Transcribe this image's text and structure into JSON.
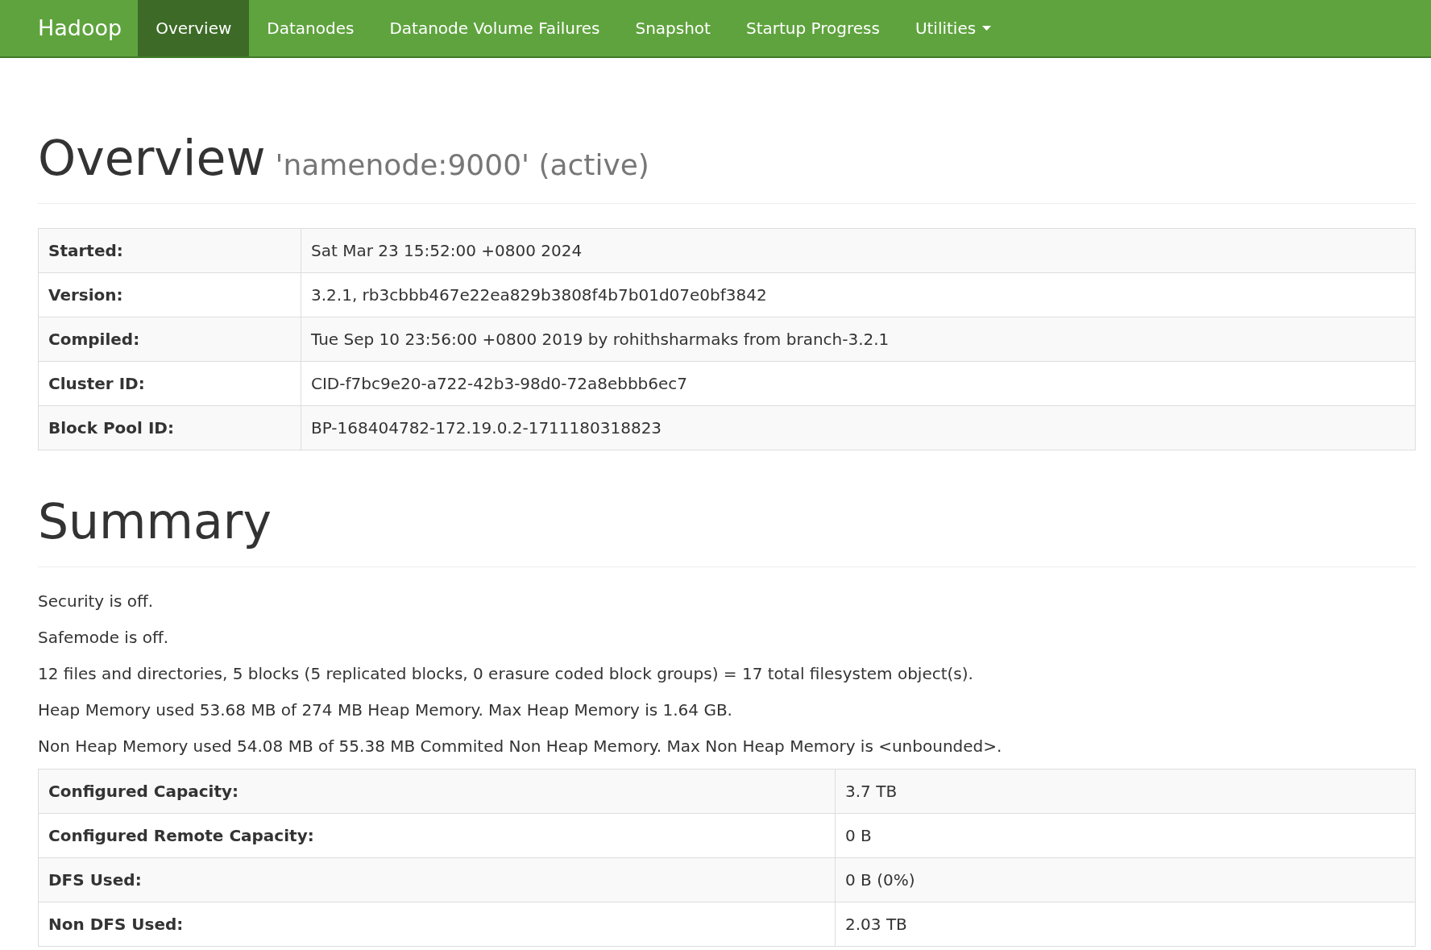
{
  "navbar": {
    "brand": "Hadoop",
    "items": [
      {
        "label": "Overview",
        "selected": true,
        "dropdown": false
      },
      {
        "label": "Datanodes",
        "selected": false,
        "dropdown": false
      },
      {
        "label": "Datanode Volume Failures",
        "selected": false,
        "dropdown": false
      },
      {
        "label": "Snapshot",
        "selected": false,
        "dropdown": false
      },
      {
        "label": "Startup Progress",
        "selected": false,
        "dropdown": false
      },
      {
        "label": "Utilities",
        "selected": false,
        "dropdown": true
      }
    ]
  },
  "overview": {
    "title": "Overview",
    "subtitle": "'namenode:9000' (active)",
    "rows": [
      {
        "label": "Started:",
        "value": "Sat Mar 23 15:52:00 +0800 2024"
      },
      {
        "label": "Version:",
        "value": "3.2.1, rb3cbbb467e22ea829b3808f4b7b01d07e0bf3842"
      },
      {
        "label": "Compiled:",
        "value": "Tue Sep 10 23:56:00 +0800 2019 by rohithsharmaks from branch-3.2.1"
      },
      {
        "label": "Cluster ID:",
        "value": "CID-f7bc9e20-a722-42b3-98d0-72a8ebbb6ec7"
      },
      {
        "label": "Block Pool ID:",
        "value": "BP-168404782-172.19.0.2-1711180318823"
      }
    ]
  },
  "summary": {
    "title": "Summary",
    "lines": [
      "Security is off.",
      "Safemode is off.",
      "12 files and directories, 5 blocks (5 replicated blocks, 0 erasure coded block groups) = 17 total filesystem object(s).",
      "Heap Memory used 53.68 MB of 274 MB Heap Memory. Max Heap Memory is 1.64 GB.",
      "Non Heap Memory used 54.08 MB of 55.38 MB Commited Non Heap Memory. Max Non Heap Memory is <unbounded>."
    ],
    "rows": [
      {
        "label": "Configured Capacity:",
        "value": "3.7 TB"
      },
      {
        "label": "Configured Remote Capacity:",
        "value": "0 B"
      },
      {
        "label": "DFS Used:",
        "value": "0 B (0%)"
      },
      {
        "label": "Non DFS Used:",
        "value": "2.03 TB"
      }
    ]
  }
}
